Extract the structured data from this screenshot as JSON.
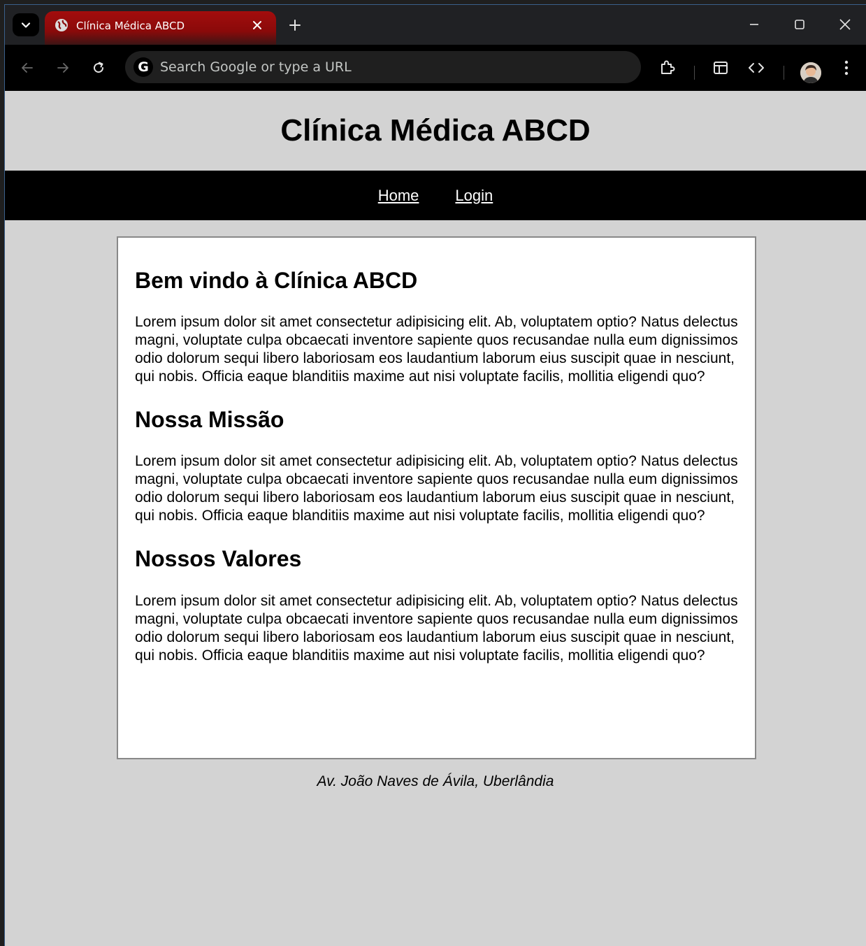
{
  "browser": {
    "tab": {
      "title": "Clínica Médica ABCD"
    },
    "omnibox": {
      "placeholder": "Search Google or type a URL",
      "g_label": "G"
    }
  },
  "page": {
    "site_title": "Clínica Médica ABCD",
    "nav": [
      {
        "label": "Home"
      },
      {
        "label": "Login"
      }
    ],
    "sections": [
      {
        "heading": "Bem vindo à Clínica ABCD",
        "text": "Lorem ipsum dolor sit amet consectetur adipisicing elit. Ab, voluptatem optio? Natus delectus magni, voluptate culpa obcaecati inventore sapiente quos recusandae nulla eum dignissimos odio dolorum sequi libero laboriosam eos laudantium laborum eius suscipit quae in nesciunt, qui nobis. Officia eaque blanditiis maxime aut nisi voluptate facilis, mollitia eligendi quo?"
      },
      {
        "heading": "Nossa Missão",
        "text": "Lorem ipsum dolor sit amet consectetur adipisicing elit. Ab, voluptatem optio? Natus delectus magni, voluptate culpa obcaecati inventore sapiente quos recusandae nulla eum dignissimos odio dolorum sequi libero laboriosam eos laudantium laborum eius suscipit quae in nesciunt, qui nobis. Officia eaque blanditiis maxime aut nisi voluptate facilis, mollitia eligendi quo?"
      },
      {
        "heading": "Nossos Valores",
        "text": "Lorem ipsum dolor sit amet consectetur adipisicing elit. Ab, voluptatem optio? Natus delectus magni, voluptate culpa obcaecati inventore sapiente quos recusandae nulla eum dignissimos odio dolorum sequi libero laboriosam eos laudantium laborum eius suscipit quae in nesciunt, qui nobis. Officia eaque blanditiis maxime aut nisi voluptate facilis, mollitia eligendi quo?"
      }
    ],
    "footer": "Av. João Naves de Ávila, Uberlândia"
  },
  "colors": {
    "tab_active": "#a30d0d",
    "page_bg": "#d3d3d3",
    "nav_bg": "#000000",
    "content_border": "#888888"
  },
  "icons": [
    "tab-search-icon",
    "globe-icon",
    "close-icon",
    "plus-icon",
    "minimize-icon",
    "maximize-icon",
    "window-close-icon",
    "back-arrow-icon",
    "forward-arrow-icon",
    "reload-icon",
    "google-icon",
    "extensions-icon",
    "side-panel-icon",
    "devtools-icon",
    "avatar",
    "more-menu-icon"
  ]
}
